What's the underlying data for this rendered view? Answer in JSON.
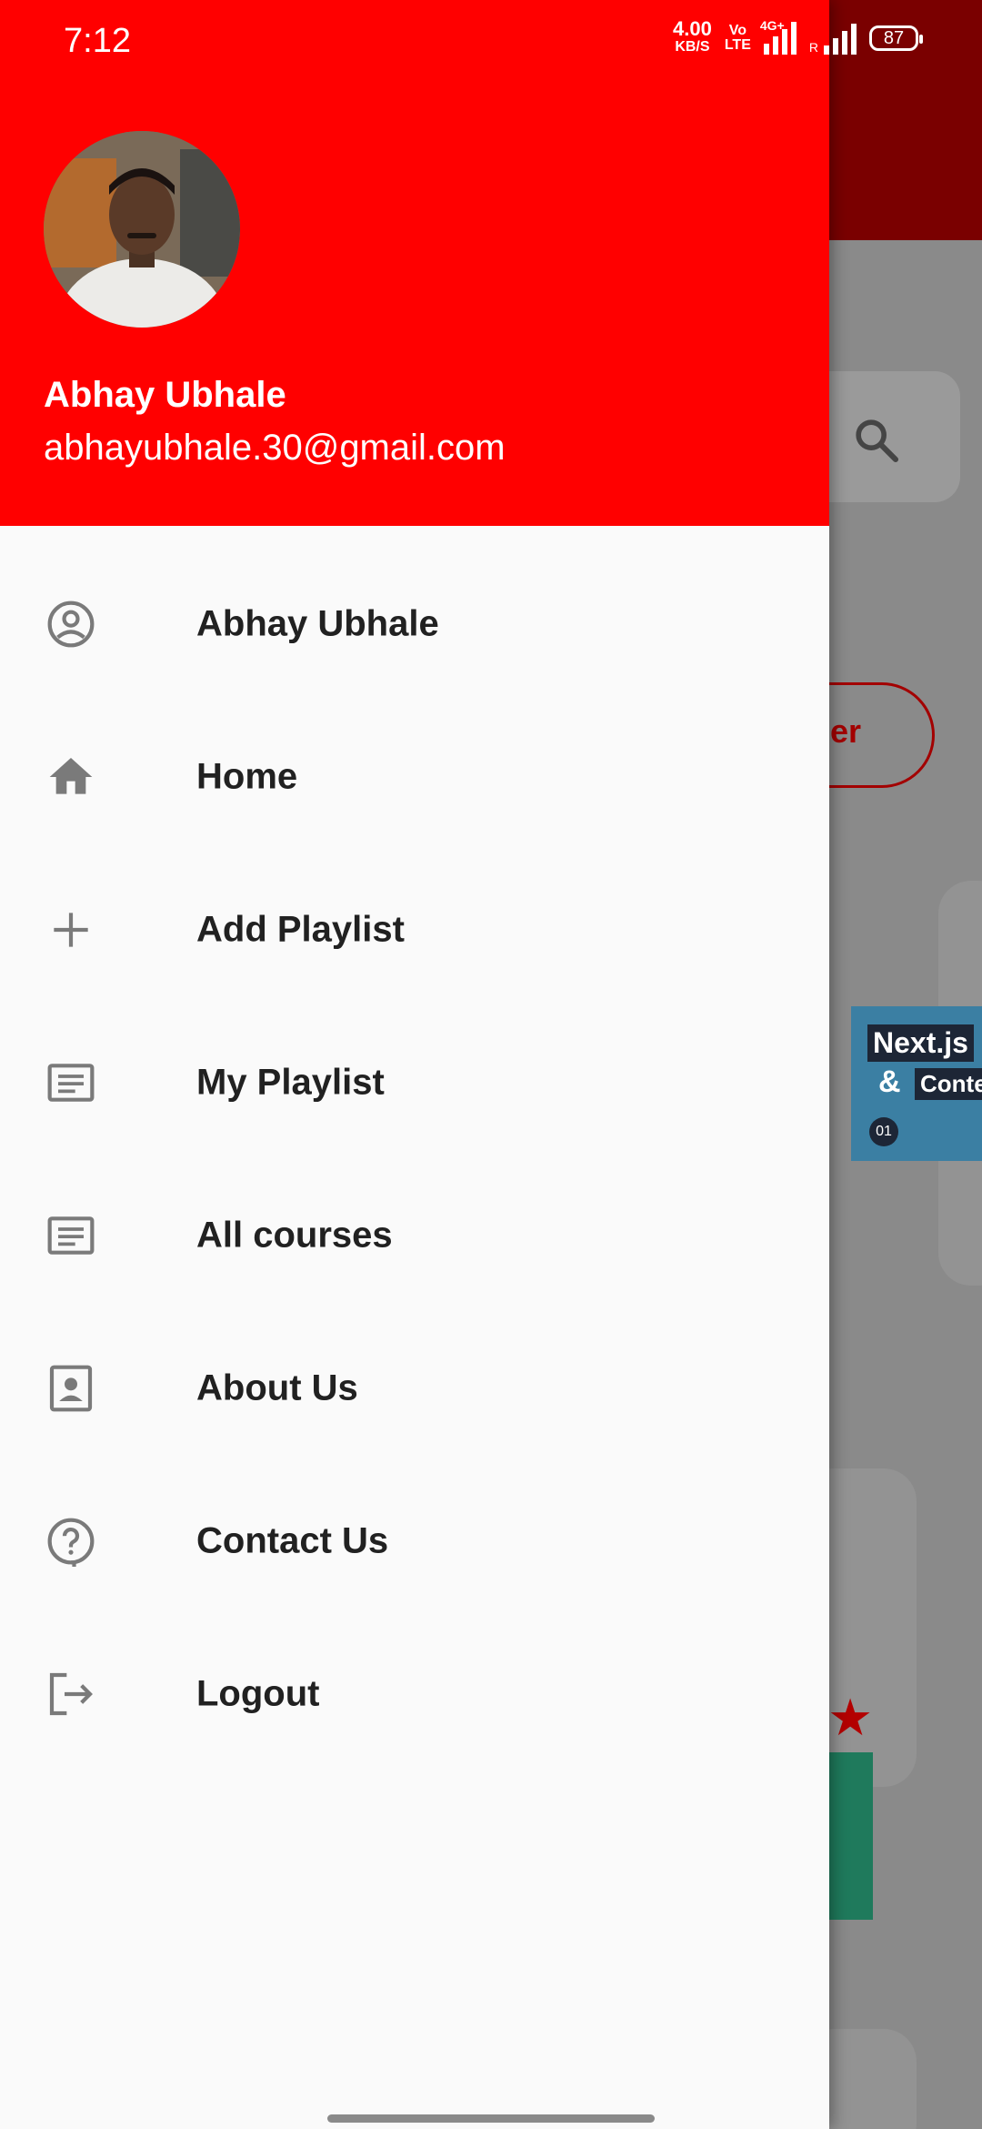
{
  "status_bar": {
    "time": "7:12",
    "net_speed_value": "4.00",
    "net_speed_unit": "KB/S",
    "volte_top": "Vo",
    "volte_bottom": "LTE",
    "network_type": "4G+",
    "roaming": "R",
    "battery_level": "87"
  },
  "drawer": {
    "header_color": "#ff0000",
    "user_name": "Abhay Ubhale",
    "user_email": "abhayubhale.30@gmail.com",
    "menu": [
      {
        "label": "Abhay Ubhale",
        "icon": "account-circle-icon"
      },
      {
        "label": "Home",
        "icon": "home-icon"
      },
      {
        "label": "Add Playlist",
        "icon": "plus-icon"
      },
      {
        "label": "My Playlist",
        "icon": "article-icon"
      },
      {
        "label": "All courses",
        "icon": "article-icon"
      },
      {
        "label": "About Us",
        "icon": "contact-card-icon"
      },
      {
        "label": "Contact Us",
        "icon": "help-icon"
      },
      {
        "label": "Logout",
        "icon": "logout-icon"
      }
    ]
  },
  "background": {
    "filter_button_partial": "er",
    "thumbnail_title": "Next.js",
    "thumbnail_amp": "&",
    "thumbnail_sub": "Conte",
    "thumbnail_num": "01"
  }
}
